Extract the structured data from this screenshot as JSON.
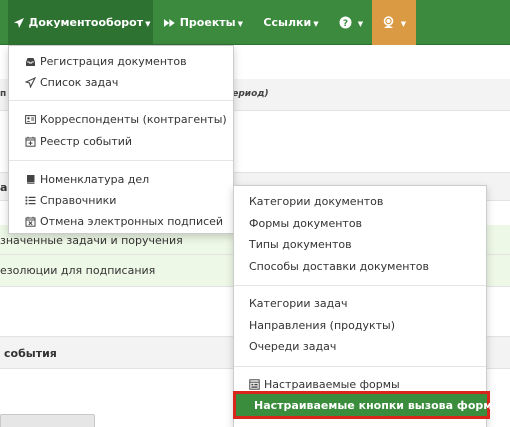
{
  "navbar": {
    "documents_label": "Документооборот",
    "projects_label": "Проекты",
    "links_label": "Ссылки",
    "help_icon": "question-circle-icon",
    "user_icon": "headset-user-icon",
    "background_color": "#3b8a3e",
    "active_color": "#2e7231",
    "user_color": "#d99a43"
  },
  "background": {
    "header_fragment_left": "п",
    "header_period": "период)",
    "section1_fragment": "а",
    "row_tasks": "значенные задачи и поручения",
    "row_resolutions": "езолюции для подписания",
    "section2_label": "события"
  },
  "documents_menu": {
    "items": [
      {
        "label": "Регистрация документов",
        "icon": "inbox-icon"
      },
      {
        "label": "Список задач",
        "icon": "send-icon"
      },
      {
        "label": "Корреспонденты (контрагенты)",
        "icon": "contact-card-icon"
      },
      {
        "label": "Реестр событий",
        "icon": "calendar-plus-icon"
      },
      {
        "label": "Номенклатура дел",
        "icon": "book-icon"
      },
      {
        "label": "Справочники",
        "icon": "list-icon"
      },
      {
        "label": "Отмена электронных подписей",
        "icon": "calendar-x-icon"
      }
    ]
  },
  "directories_menu": {
    "items": [
      {
        "label": "Категории документов"
      },
      {
        "label": "Формы документов"
      },
      {
        "label": "Типы документов"
      },
      {
        "label": "Способы доставки документов"
      },
      {
        "label": "Категории задач"
      },
      {
        "label": "Направления (продукты)"
      },
      {
        "label": "Очереди задач"
      },
      {
        "label": "Настраиваемые формы",
        "icon": "form-icon"
      }
    ],
    "highlighted": {
      "label": "Настраиваемые кнопки вызова форм",
      "icon": "square-icon",
      "background_color": "#3a8d3c",
      "border_color": "#d9261c"
    }
  }
}
